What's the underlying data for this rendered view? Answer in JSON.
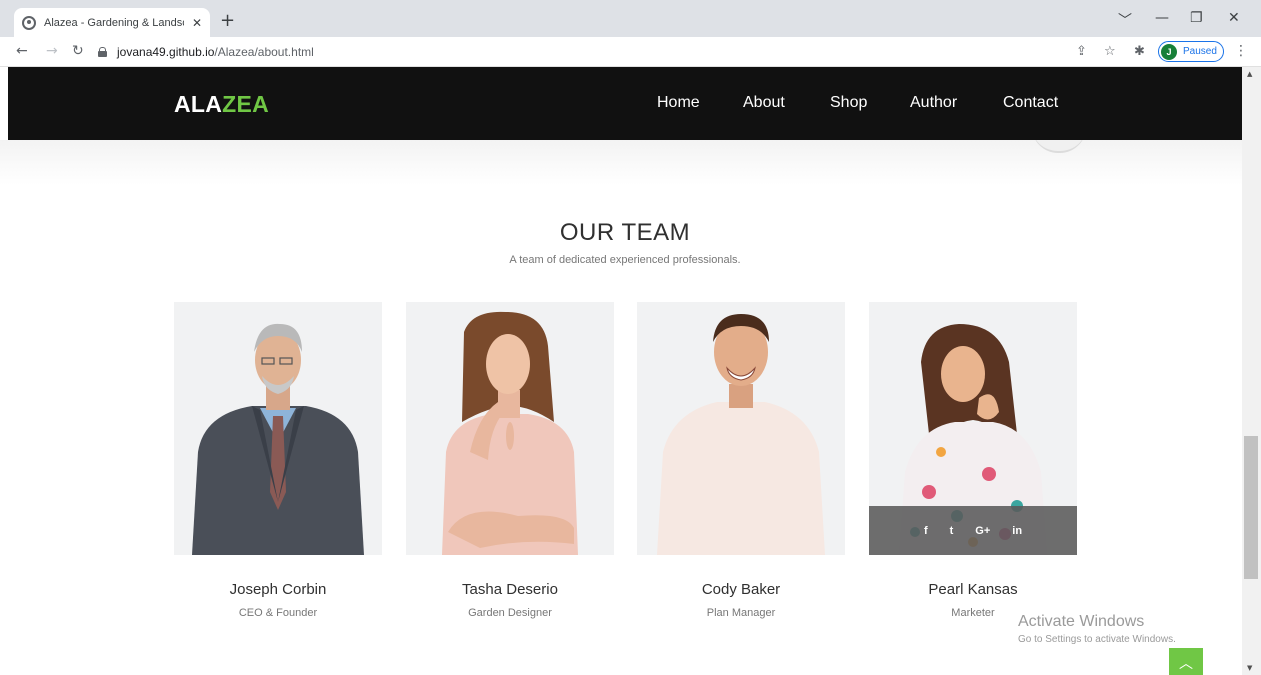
{
  "browser": {
    "tab_title": "Alazea - Gardening & Landscaping",
    "tab_close": "✕",
    "new_tab": "+",
    "url_host": "jovana49.github.io",
    "url_path": "/Alazea/about.html",
    "profile_initial": "J",
    "profile_status": "Paused",
    "window_controls": [
      "﹀",
      "—",
      "❐",
      "✕"
    ]
  },
  "site": {
    "logo_main": "ALA",
    "logo_accent": "ZEA",
    "nav": [
      "Home",
      "About",
      "Shop",
      "Author",
      "Contact"
    ],
    "accent_color": "#70c745",
    "header_color": "#111111"
  },
  "team": {
    "title": "OUR TEAM",
    "subtitle": "A team of dedicated experienced professionals.",
    "members": [
      {
        "name": "Joseph Corbin",
        "role": "CEO & Founder"
      },
      {
        "name": "Tasha Deserio",
        "role": "Garden Designer"
      },
      {
        "name": "Cody Baker",
        "role": "Plan Manager"
      },
      {
        "name": "Pearl Kansas",
        "role": "Marketer"
      }
    ],
    "social": [
      "f",
      "t",
      "G+",
      "in"
    ]
  },
  "watermark": {
    "line1": "Activate Windows",
    "line2": "Go to Settings to activate Windows."
  }
}
